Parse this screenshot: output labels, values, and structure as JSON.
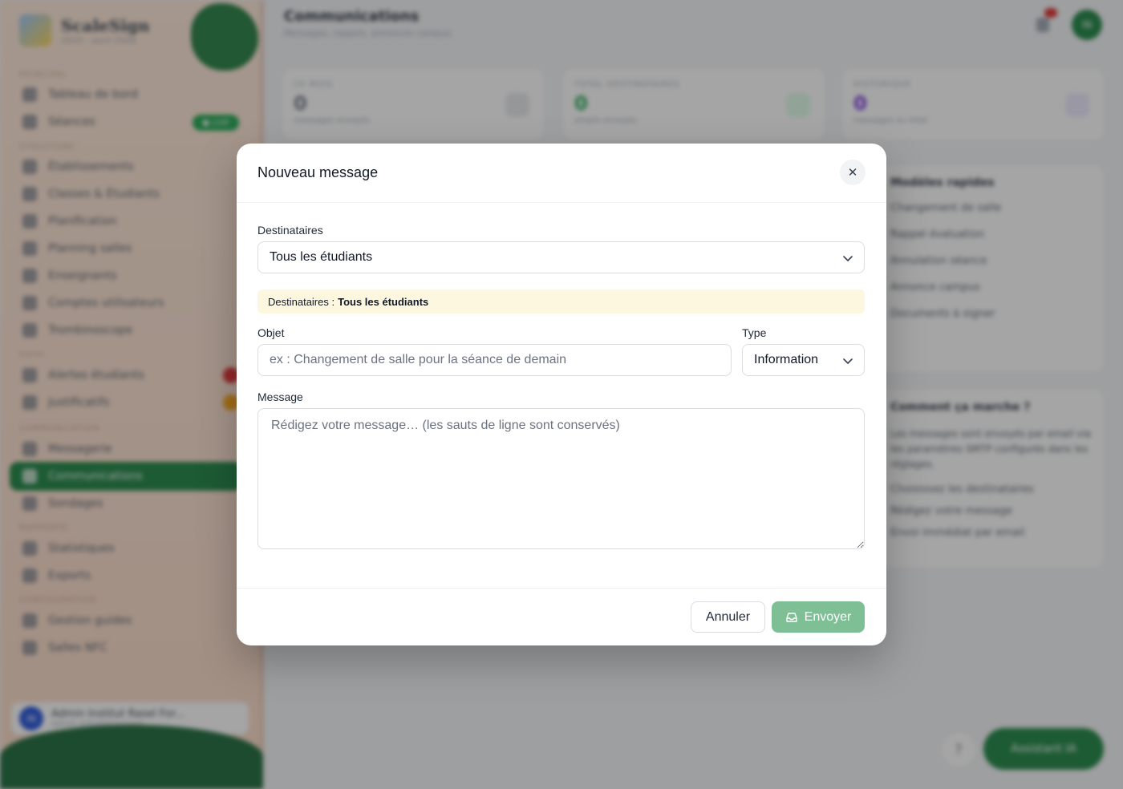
{
  "app": {
    "brand_name": "ScaleSign",
    "brand_sub": "2025 · avril 2026",
    "page_title": "Communications",
    "page_subtitle": "Messages, rappels, annonces campus",
    "avatar_initials": "IN",
    "live_badge": "● LIVE",
    "sections": [
      "PRINCIPAL",
      "STRUCTURE",
      "SUIVI",
      "COMMUNICATION",
      "RAPPORTS",
      "CONFIGURATION"
    ],
    "nav_items": [
      "Tableau de bord",
      "Séances",
      "Établissements",
      "Classes & Étudiants",
      "Planification",
      "Planning salles",
      "Enseignants",
      "Comptes utilisateurs",
      "Trombinoscope",
      "Alertes étudiants",
      "Justificatifs",
      "Messagerie",
      "Communications",
      "Sondages",
      "Statistiques",
      "Exports",
      "Gestion guides",
      "Salles NFC"
    ],
    "user_name": "Admin Institut Rasel For...",
    "user_role": "Admin d'établissement",
    "stats": [
      {
        "label": "CE MOIS",
        "value": "0",
        "sub": "messages envoyés",
        "color": "#6b7280"
      },
      {
        "label": "TOTAL DESTINATAIRES",
        "value": "0",
        "sub": "emails envoyés",
        "color": "#16a34a"
      },
      {
        "label": "HISTORIQUE",
        "value": "0",
        "sub": "messages au total",
        "color": "#6d28d9"
      }
    ],
    "quick_title": "Modèles rapides",
    "quick_items": [
      "Changement de salle",
      "Rappel évaluation",
      "Annulation séance",
      "Annonce campus",
      "Documents à signer"
    ],
    "how_title": "Comment ça marche ?",
    "how_text": "Les messages sont envoyés par email via les paramètres SMTP configurés dans les réglages.",
    "how_steps": [
      "Choisissez les destinataires",
      "Rédigez votre message",
      "Envoi immédiat par email"
    ],
    "help_label": "?",
    "assistant_label": "Assistant IA"
  },
  "modal": {
    "title": "Nouveau message",
    "close_glyph": "✕",
    "recipients_label": "Destinataires",
    "recipients_value": "Tous les étudiants",
    "banner_prefix": "Destinataires :",
    "banner_value": "Tous les étudiants",
    "subject_label": "Objet",
    "subject_placeholder": "ex : Changement de salle pour la séance de demain",
    "type_label": "Type",
    "type_value": "Information",
    "message_label": "Message",
    "message_placeholder": "Rédigez votre message… (les sauts de ligne sont conservés)",
    "cancel_label": "Annuler",
    "send_label": "Envoyer",
    "accent": "#7fbf96"
  }
}
